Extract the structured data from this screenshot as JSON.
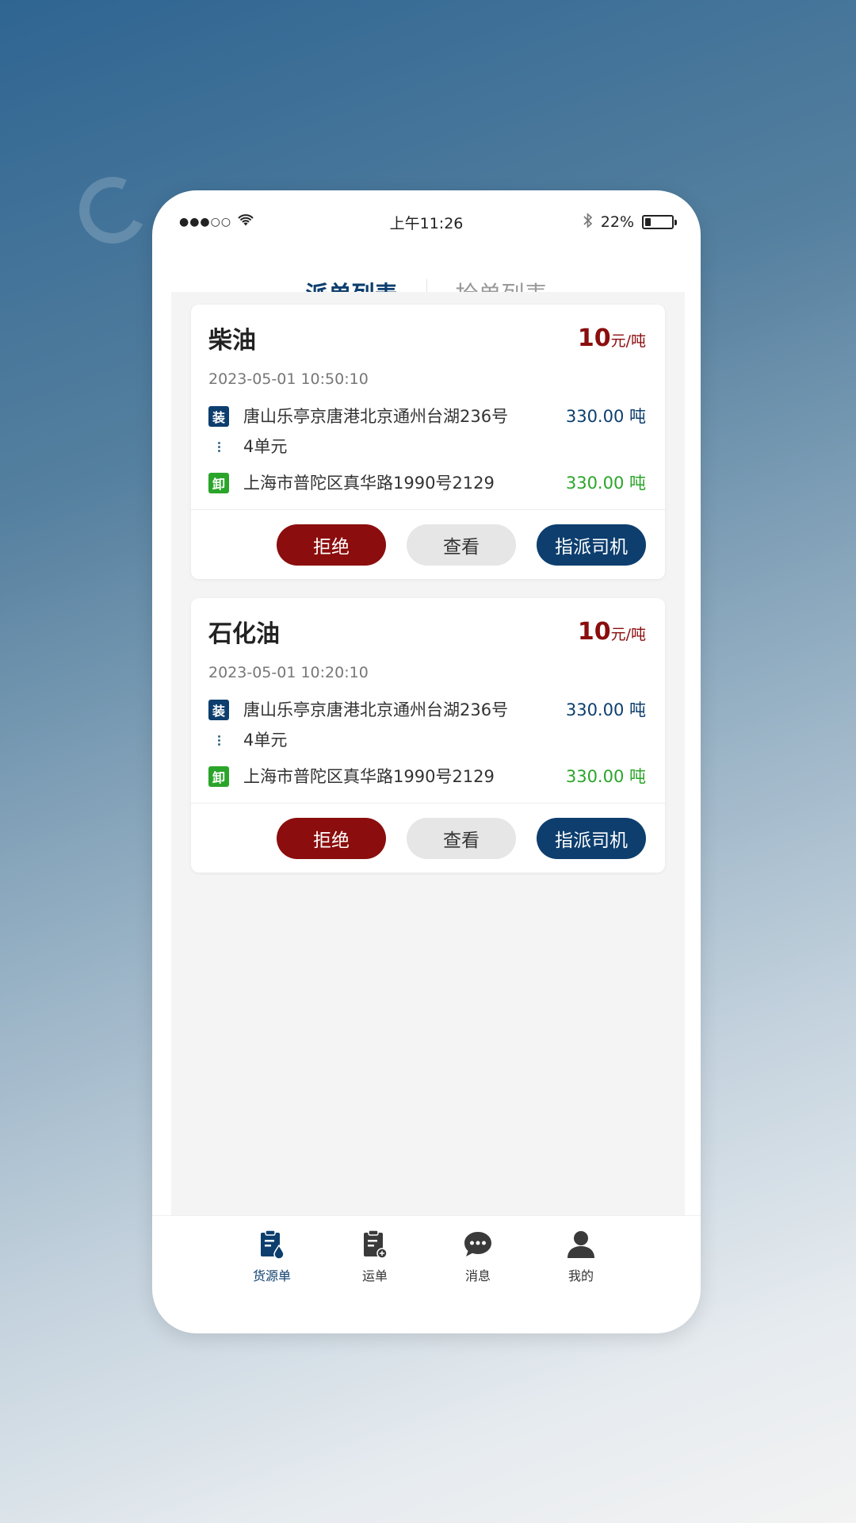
{
  "status_bar": {
    "signal": "●●●○○",
    "time": "上午11:26",
    "battery_percent": "22%",
    "battery_level": 0.22
  },
  "tabs": [
    {
      "label": "派单列表",
      "active": true
    },
    {
      "label": "抢单列表",
      "active": false
    }
  ],
  "orders": [
    {
      "cargo": "柴油",
      "price": "10",
      "price_unit": "元/吨",
      "time": "2023-05-01 10:50:10",
      "load_tag": "装",
      "load_address_line1": "唐山乐亭京唐港北京通州台湖236号",
      "load_address_line2": "4单元",
      "load_weight": "330.00 吨",
      "unload_tag": "卸",
      "unload_address": "上海市普陀区真华路1990号2129",
      "unload_weight": "330.00 吨",
      "actions": {
        "reject": "拒绝",
        "view": "查看",
        "assign": "指派司机"
      }
    },
    {
      "cargo": "石化油",
      "price": "10",
      "price_unit": "元/吨",
      "time": "2023-05-01 10:20:10",
      "load_tag": "装",
      "load_address_line1": "唐山乐亭京唐港北京通州台湖236号",
      "load_address_line2": "4单元",
      "load_weight": "330.00 吨",
      "unload_tag": "卸",
      "unload_address": "上海市普陀区真华路1990号2129",
      "unload_weight": "330.00 吨",
      "actions": {
        "reject": "拒绝",
        "view": "查看",
        "assign": "指派司机"
      }
    }
  ],
  "bottom_nav": [
    {
      "label": "货源单",
      "icon": "cargo-source-icon",
      "active": true
    },
    {
      "label": "运单",
      "icon": "waybill-icon",
      "active": false
    },
    {
      "label": "消息",
      "icon": "message-icon",
      "active": false
    },
    {
      "label": "我的",
      "icon": "user-icon",
      "active": false
    }
  ],
  "colors": {
    "primary": "#0d3e6e",
    "reject": "#8b0d0d",
    "unload": "#2aa52a",
    "view_button": "#e6e6e6"
  }
}
